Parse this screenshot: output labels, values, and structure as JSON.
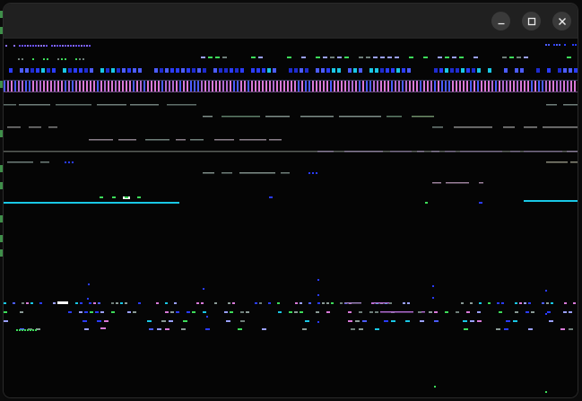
{
  "window": {
    "title": "",
    "controls": {
      "minimize_icon": "minimize-icon",
      "maximize_icon": "maximize-icon",
      "close_icon": "close-icon"
    }
  },
  "colors": {
    "titlebar": "#202020",
    "canvas": "#050505",
    "control_button": "#3a3a3a",
    "pink": "#d97ad9",
    "blue": "#2a3cff",
    "cyan": "#19c8e6",
    "green": "#3ddc5a",
    "gray": "#6f7f7a",
    "white": "#ffffff"
  }
}
